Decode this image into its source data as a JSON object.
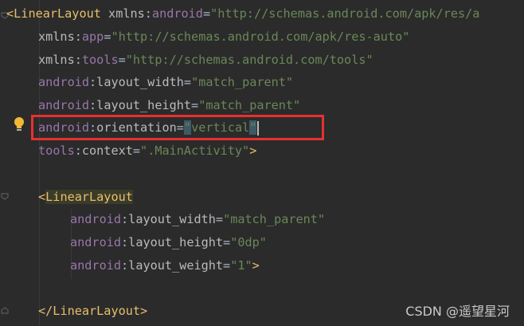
{
  "code": {
    "line1": {
      "bracket": "<",
      "tag": "LinearLayout",
      "space": " ",
      "ns": "xmlns",
      "colon": ":",
      "attr": "android",
      "eq": "=",
      "value": "\"http://schemas.android.com/apk/res/a"
    },
    "line2": {
      "ns": "xmlns",
      "colon": ":",
      "attr": "app",
      "eq": "=",
      "value": "\"http://schemas.android.com/apk/res-auto\""
    },
    "line3": {
      "ns": "xmlns",
      "colon": ":",
      "attr": "tools",
      "eq": "=",
      "value": "\"http://schemas.android.com/tools\""
    },
    "line4": {
      "ns": "android",
      "colon": ":",
      "attr": "layout_width",
      "eq": "=",
      "value": "\"match_parent\""
    },
    "line5": {
      "ns": "android",
      "colon": ":",
      "attr": "layout_height",
      "eq": "=",
      "value": "\"match_parent\""
    },
    "line6": {
      "ns": "android",
      "colon": ":",
      "attr": "orientation",
      "eq": "=",
      "quote_open": "\"",
      "value": "vertical",
      "quote_close": "\""
    },
    "line7": {
      "ns": "tools",
      "colon": ":",
      "attr": "context",
      "eq": "=",
      "value": "\".MainActivity\"",
      "close": ">"
    },
    "line9": {
      "bracket": "<",
      "tag": "LinearLayout"
    },
    "line10": {
      "ns": "android",
      "colon": ":",
      "attr": "layout_width",
      "eq": "=",
      "value": "\"match_parent\""
    },
    "line11": {
      "ns": "android",
      "colon": ":",
      "attr": "layout_height",
      "eq": "=",
      "value": "\"0dp\""
    },
    "line12": {
      "ns": "android",
      "colon": ":",
      "attr": "layout_weight",
      "eq": "=",
      "value": "\"1\"",
      "close": ">"
    },
    "line14": {
      "bracket": "</",
      "tag": "LinearLayout",
      "close": ">"
    }
  },
  "watermark": "CSDN @遥望星河",
  "colors": {
    "background": "#2b2b2b",
    "tag": "#e8bf6a",
    "namespace": "#9876aa",
    "attribute": "#bababa",
    "string": "#6a8759",
    "highlight_box": "#e83030"
  },
  "icons": {
    "bulb": "lightbulb-icon",
    "fold": "fold-marker-icon"
  }
}
